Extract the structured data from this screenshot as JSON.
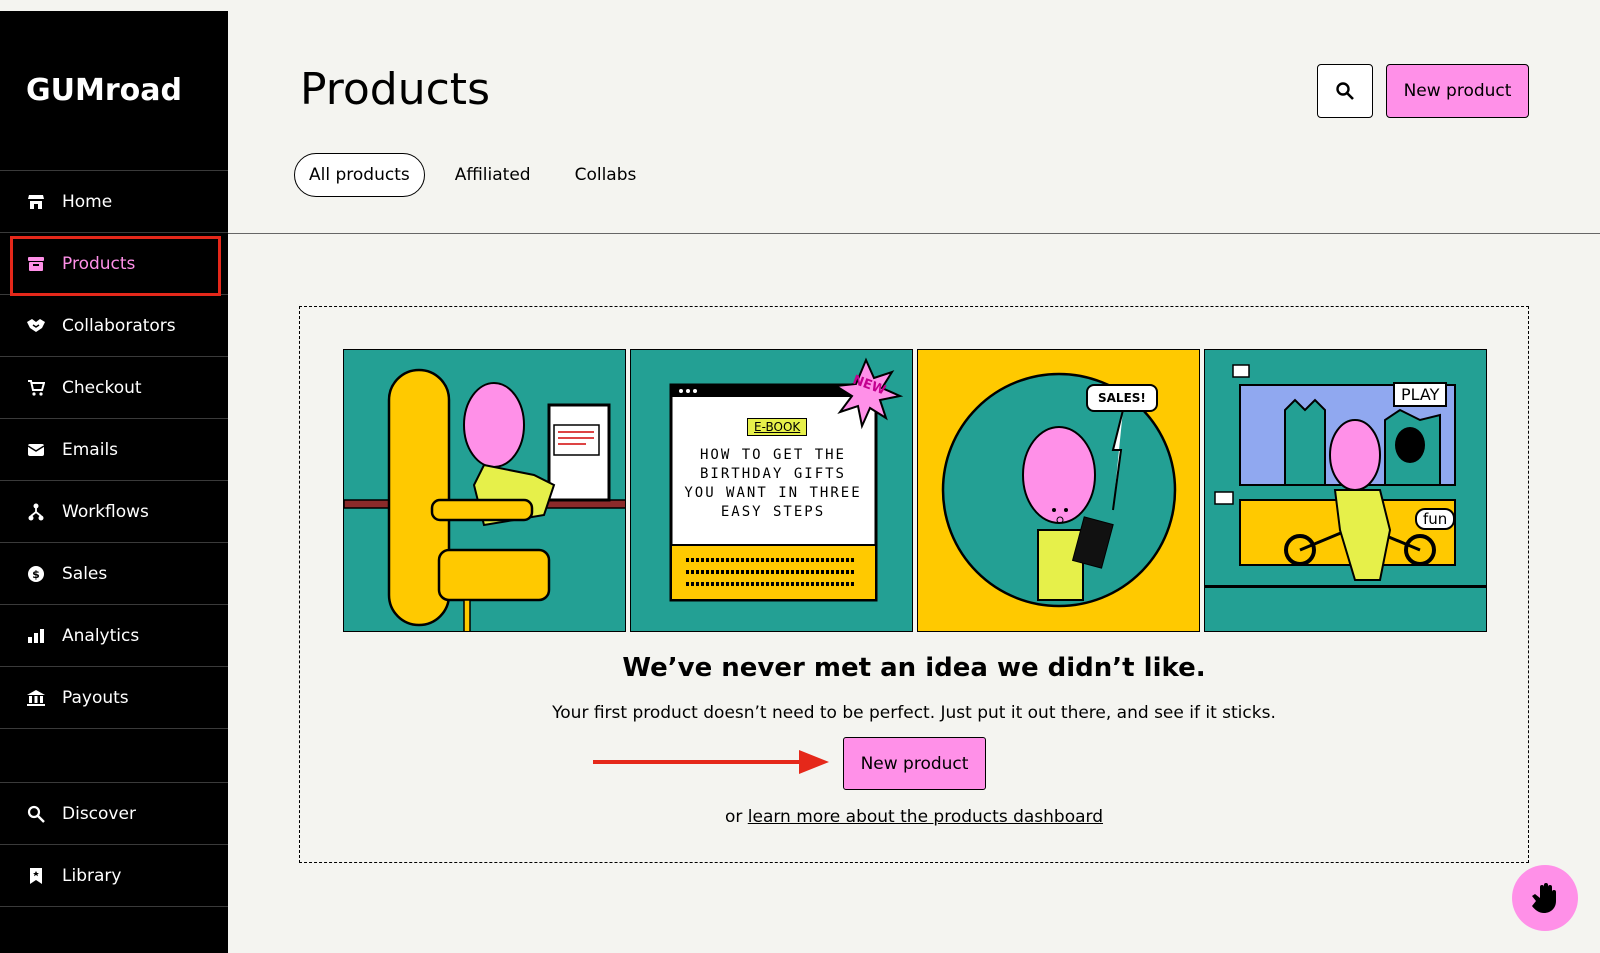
{
  "brand": {
    "logo_text": "GUMroad"
  },
  "sidebar": {
    "items": [
      {
        "label": "Home",
        "icon": "store-icon"
      },
      {
        "label": "Products",
        "icon": "archive-box-icon",
        "active": true
      },
      {
        "label": "Collaborators",
        "icon": "handshake-icon"
      },
      {
        "label": "Checkout",
        "icon": "cart-icon"
      },
      {
        "label": "Emails",
        "icon": "envelope-icon"
      },
      {
        "label": "Workflows",
        "icon": "workflow-icon"
      },
      {
        "label": "Sales",
        "icon": "dollar-coin-icon"
      },
      {
        "label": "Analytics",
        "icon": "bar-chart-icon"
      },
      {
        "label": "Payouts",
        "icon": "bank-icon"
      }
    ],
    "bottom_items": [
      {
        "label": "Discover",
        "icon": "search-icon"
      },
      {
        "label": "Library",
        "icon": "bookmark-icon"
      }
    ]
  },
  "header": {
    "title": "Products",
    "new_product_label": "New product",
    "tabs": [
      {
        "label": "All products",
        "active": true
      },
      {
        "label": "Affiliated"
      },
      {
        "label": "Collabs"
      }
    ]
  },
  "empty_state": {
    "illustration_text": {
      "ebook_tag": "E-BOOK",
      "ebook_title": "HOW TO GET THE BIRTHDAY GIFTS YOU WANT IN THREE EASY STEPS",
      "new_burst": "NEW",
      "sales_bubble": "SALES!",
      "play_bubble": "PLAY",
      "fun_tag": "fun"
    },
    "headline": "We’ve never met an idea we didn’t like.",
    "subline": "Your first product doesn’t need to be perfect. Just put it out there, and see if it sticks.",
    "button_label": "New product",
    "learn_prefix": "or ",
    "learn_link": "learn more about the products dashboard"
  },
  "colors": {
    "accent_pink": "#ff90e8",
    "teal": "#23a094",
    "yellow": "#ffc900",
    "annotation_red": "#e5281a"
  }
}
